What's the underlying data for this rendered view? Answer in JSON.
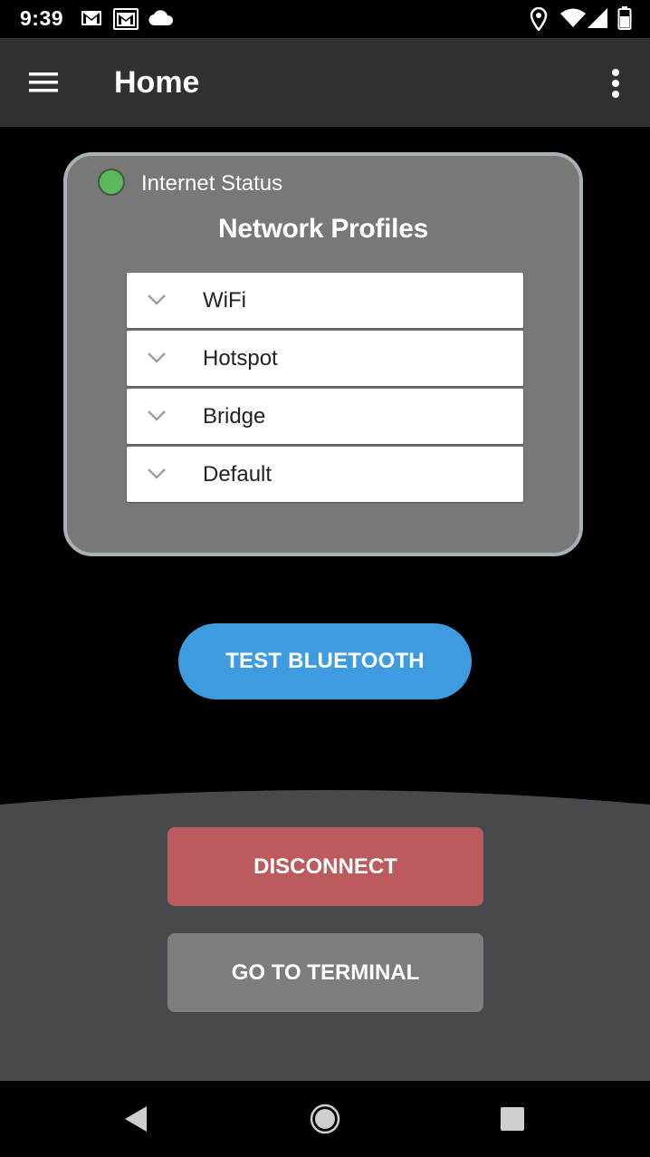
{
  "status_bar": {
    "time": "9:39",
    "icons": [
      "gmail-icon",
      "gmail-icon",
      "cloud-icon",
      "location-icon",
      "wifi-icon",
      "signal-icon",
      "battery-icon"
    ]
  },
  "app_bar": {
    "title": "Home",
    "menu_icon": "hamburger-menu-icon",
    "overflow_icon": "more-vert-icon"
  },
  "card": {
    "status_label": "Internet Status",
    "status_color": "#5cb85c",
    "title": "Network Profiles",
    "profiles": [
      {
        "label": "WiFi"
      },
      {
        "label": "Hotspot"
      },
      {
        "label": "Bridge"
      },
      {
        "label": "Default"
      }
    ]
  },
  "buttons": {
    "test_bluetooth": "TEST BLUETOOTH",
    "disconnect": "DISCONNECT",
    "go_to_terminal": "GO TO TERMINAL"
  },
  "colors": {
    "app_bar": "#313131",
    "card_bg": "#787878",
    "card_border": "#a7b2b6",
    "bluetooth_button": "#3e9be0",
    "disconnect_button": "#bc5b5e",
    "terminal_button": "#7d7d7d",
    "bottom_panel": "#48494d"
  },
  "nav_bar": {
    "icons": [
      "back-icon",
      "home-icon",
      "recents-icon"
    ]
  }
}
